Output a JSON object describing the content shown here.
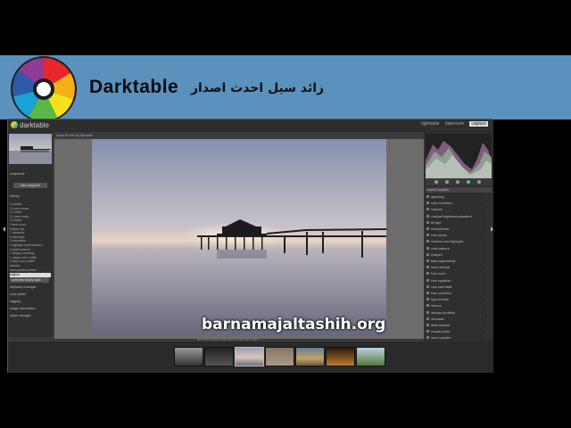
{
  "banner": {
    "brand": "Darktable",
    "subtitle": "زائد سيل احدث اصدار"
  },
  "window": {
    "app_name": "darktable",
    "views": [
      "lighttable",
      "darkroom",
      "capture"
    ],
    "active_view": "darkroom"
  },
  "left_panel": {
    "sections": {
      "snapshots": "snapshots",
      "take_snapshot": "take snapshot",
      "history": "history",
      "compress": "compress history stack",
      "duplicate": "duplicate manager",
      "color_picker": "color picker",
      "tagging": "tagging",
      "image_info": "image information",
      "mask_manager": "mask manager"
    },
    "history_items": [
      "14  velvia",
      "13  color zones",
      "12  velvia",
      "11  color zones",
      "10  velvia",
      "9  tone curve",
      "8  filmic rgb",
      "7  exposure",
      "6  demosaic",
      "5  orientation",
      "4  highlight reconstruction",
      "3  white balance",
      "2  display encoding",
      "1  output color profile",
      "0  input color profile",
      "denoise",
      "auto-applied presets"
    ],
    "selected_history": "original"
  },
  "center": {
    "toolbar": "zoom   fit          sort by   filename",
    "info_line": "1/4 f/16.0 0.5 s 135 mm 17 mm  ISO 100"
  },
  "right_panel": {
    "search_placeholder": "search modules",
    "modules": [
      "vignetting",
      "color correction",
      "lowpass",
      "contrast brightness saturation",
      "fill light",
      "monochrome",
      "color zones",
      "shadows and highlights",
      "color balance",
      "sharpen",
      "base adjustments",
      "haze removal",
      "tone curve",
      "tone equalizer",
      "crop and rotate",
      "lens correction",
      "spot removal",
      "retouch",
      "denoise (profiled)",
      "demosaic",
      "white balance",
      "rescale pixels",
      "more modules"
    ]
  },
  "watermark": "barnamajaltashih.org",
  "colors": {
    "banner": "#5b91bd",
    "panel": "#2f2f2f",
    "canvas": "#6c6c6c"
  }
}
